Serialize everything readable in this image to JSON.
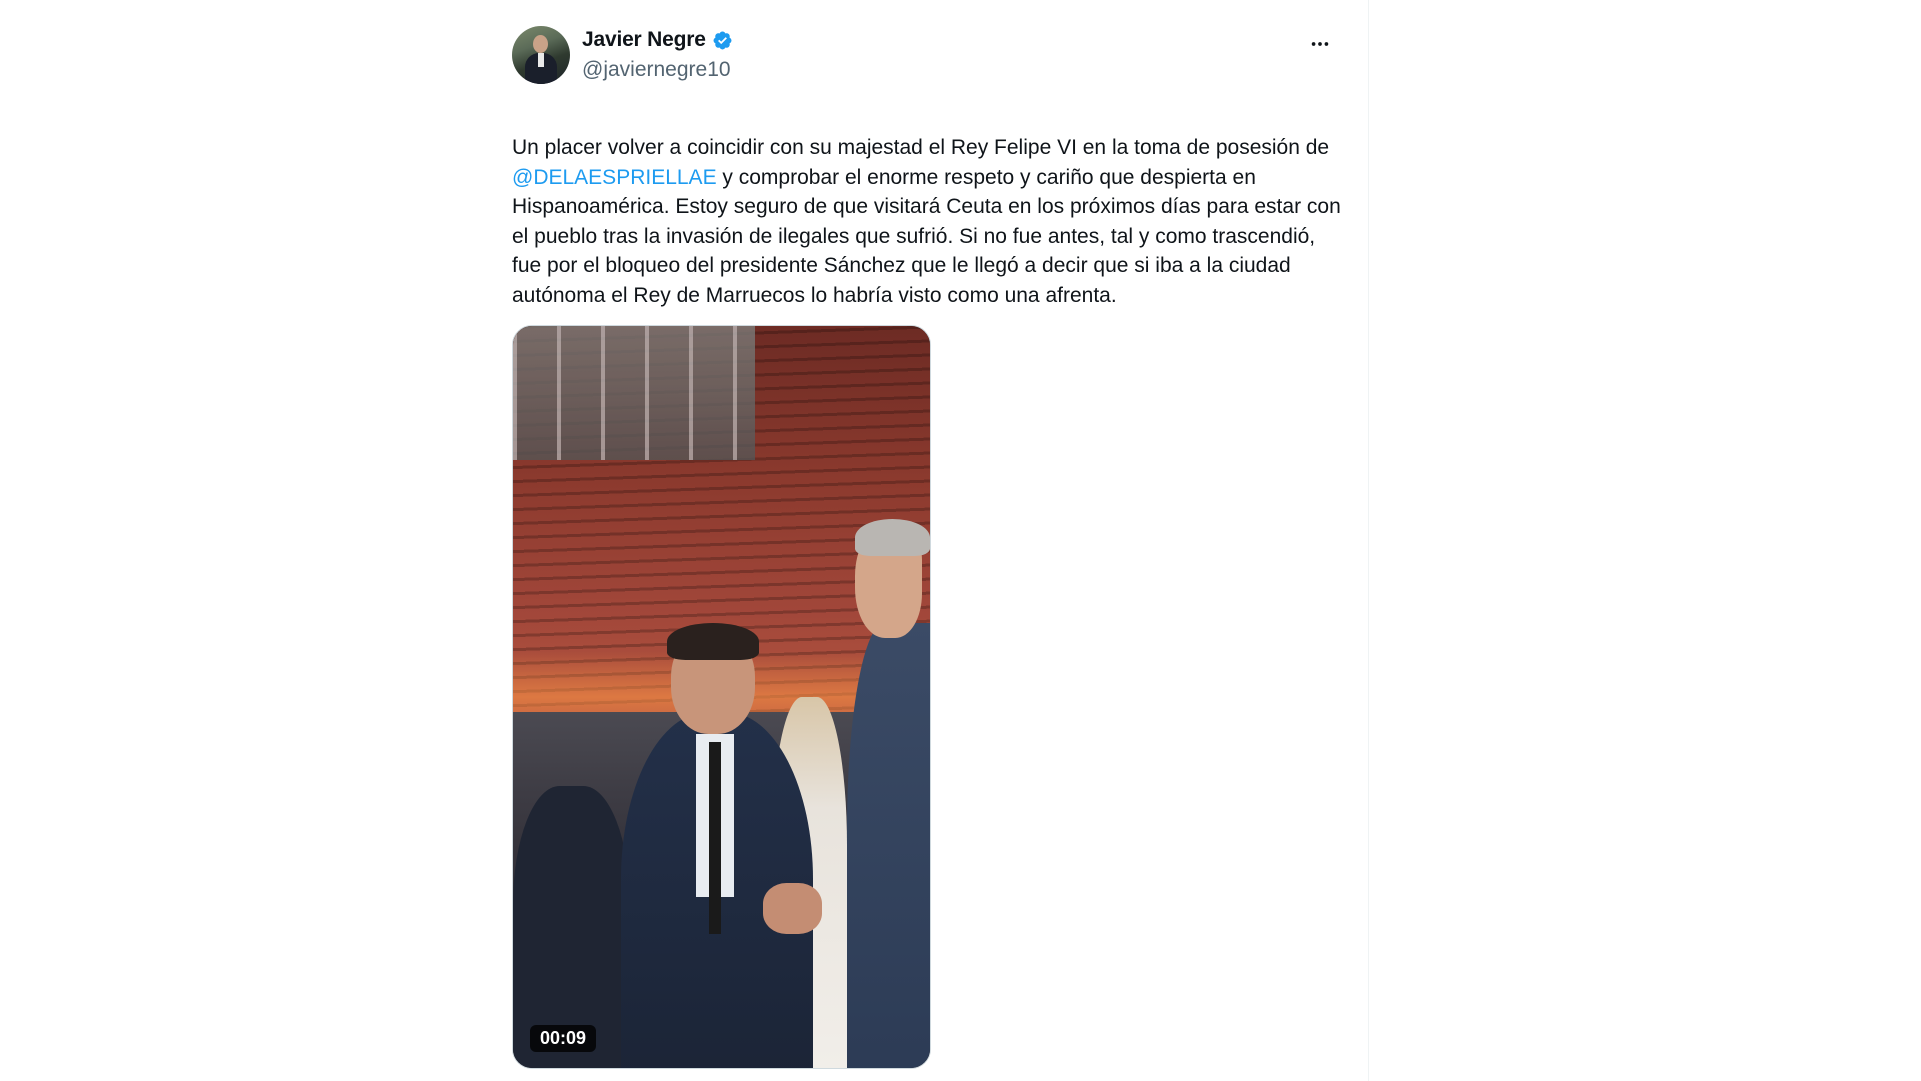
{
  "tweet": {
    "author": {
      "display_name": "Javier Negre",
      "handle": "@javiernegre10",
      "verified_icon": "verified-badge-icon",
      "verified_color": "#1d9bf0"
    },
    "more_icon": "more-horizontal-icon",
    "text": {
      "part1": "Un placer volver a coincidir con su majestad el Rey Felipe VI en la toma de posesión de ",
      "mention": "@DELAESPRIELLAE",
      "part2": " y comprobar el enorme respeto y cariño que despierta en Hispanoamérica. Estoy seguro de que visitará Ceuta en los próximos días para estar con el pueblo tras la invasión de ilegales que sufrió. Si no fue antes, tal y como trascendió, fue por el bloqueo del presidente Sánchez que le llegó a decir que si iba a la ciudad autónoma el Rey de Marruecos lo habría visto como una afrenta."
    },
    "media": {
      "type": "video",
      "duration": "00:09"
    }
  },
  "colors": {
    "text": "#0f1419",
    "secondary": "#536471",
    "link": "#1d9bf0",
    "border": "#eff3f4"
  }
}
